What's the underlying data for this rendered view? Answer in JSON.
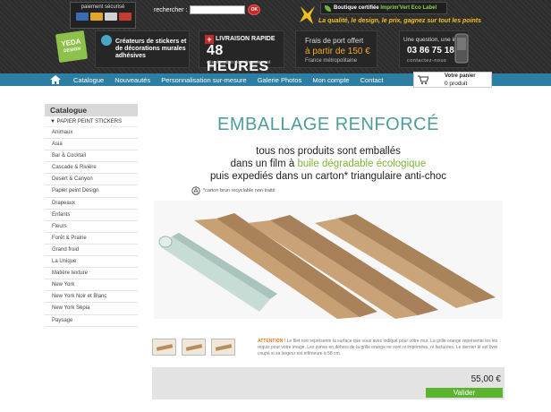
{
  "header": {
    "payment": {
      "title": "paiement sécurisé",
      "cards": [
        "#3b6bb5",
        "#e0a52a",
        "#cfd3d6",
        "#c33c32"
      ]
    },
    "search": {
      "label": "rechercher :",
      "placeholder": "",
      "button": "OK"
    },
    "certification": {
      "prefix": "Boutique certifiée",
      "brand": "Imprim'Vert Eco Label"
    },
    "slogan": "La qualité, le design, le prix, gagnez sur tout les points",
    "logo": {
      "line1": "YEDA",
      "line2": "DESIGN"
    },
    "promos": {
      "stickers": "Créateurs de stickers et de décorations murales adhésives",
      "delivery_top": "LIVRAISON RAPIDE",
      "delivery_big": "48 HEURES",
      "delivery_sub": "dès réception de votre paiement",
      "shipping_title": "Frais de port offert",
      "shipping_amount": "à partir de 150 €",
      "shipping_zone": "France métropolitaine",
      "question": "Une question, une info ?",
      "phone": "03 86 75 18 63",
      "contact": "contactez-nous"
    }
  },
  "nav": {
    "items": [
      "Catalogue",
      "Nouveautés",
      "Personnalisation sur-mesure",
      "Galerie Photos",
      "Mon compte",
      "Contact"
    ]
  },
  "cart": {
    "title": "Votre panier",
    "count": "0 produit"
  },
  "sidebar": {
    "title": "Catalogue",
    "active": "▼ PAPIER PEINT STICKERS",
    "items": [
      "Animaux",
      "Asia",
      "Bar & Cocktail",
      "Cascade & Rivière",
      "Desert & Canyon",
      "Papier peint Design",
      "Drapeaux",
      "Enfants",
      "Fleurs",
      "Forêt & Prairie",
      "Grand froid",
      "La Unique",
      "Matière texture",
      "New York",
      "New York Noir et Blanc",
      "New York Sepia",
      "Paysage"
    ]
  },
  "main": {
    "title": "EMBALLAGE RENFORCÉ",
    "line1": "tous nos produits sont emballés",
    "line2_pre": "dans un film à ",
    "line2_hl": "buile dégradable écologique",
    "line3": "puis expediés dans un carton* triangulaire anti-choc",
    "note": "*carton brun recyclable non traité",
    "attention_label": "ATTENTION !",
    "attention_text": "Le filet noir représente la surface que vous avez indiqué pour votre mur. La grille orange représente les lés requis pour votre image. Les zones en dehors de la grille orange ne sont ni imprimées, ni facturées. Le dernier lé est livré coupé si sa largeur est inférieure à 58 cm.",
    "price": "55,00 €",
    "validate": "Valider"
  },
  "colors": {
    "nav": "#2c7fa3",
    "accent_green": "#7cb73a",
    "title_teal": "#4d9e9a",
    "button_green": "#5bb330"
  }
}
